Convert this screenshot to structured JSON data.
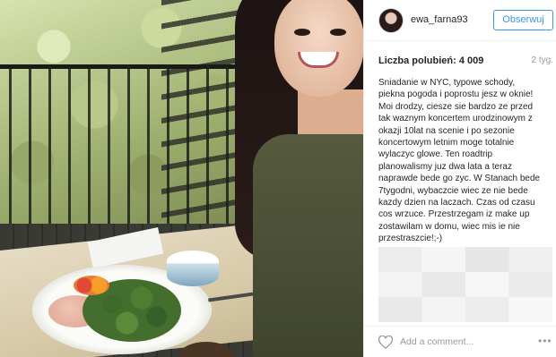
{
  "post": {
    "username": "ewa_farna93",
    "follow_label": "Obserwuj",
    "likes": "Liczba polubień: 4 009",
    "time_ago": "2 tyg.",
    "caption": "Sniadanie w NYC, typowe schody, piekna pogoda i poprostu jesz w oknie! Moi drodzy, ciesze sie bardzo ze przed tak waznym koncertem urodzinowym z okazji 10lat na scenie i po sezonie koncertowym letnim moge totalnie wylaczyc glowe. Ten roadtrip planowalismy juz dwa lata a teraz naprawde bede go zyc. W Stanach bede 7tygodni, wybaczcie wiec ze nie bede kazdy dzien na laczach. Czas od czasu cos wrzuce. Przestrzegam iz make up zostawilam w domu, wiec mis ie nie przestraszcie!;-)\nSee U!",
    "comment_placeholder": "Add a comment...",
    "more_glyph": "•••"
  },
  "icons": {
    "heart": "heart-icon",
    "more": "more-options-icon",
    "avatar": "profile-avatar"
  },
  "colors": {
    "accent": "#3897f0",
    "text": "#262626",
    "muted": "#999999",
    "divider": "#efefef"
  }
}
